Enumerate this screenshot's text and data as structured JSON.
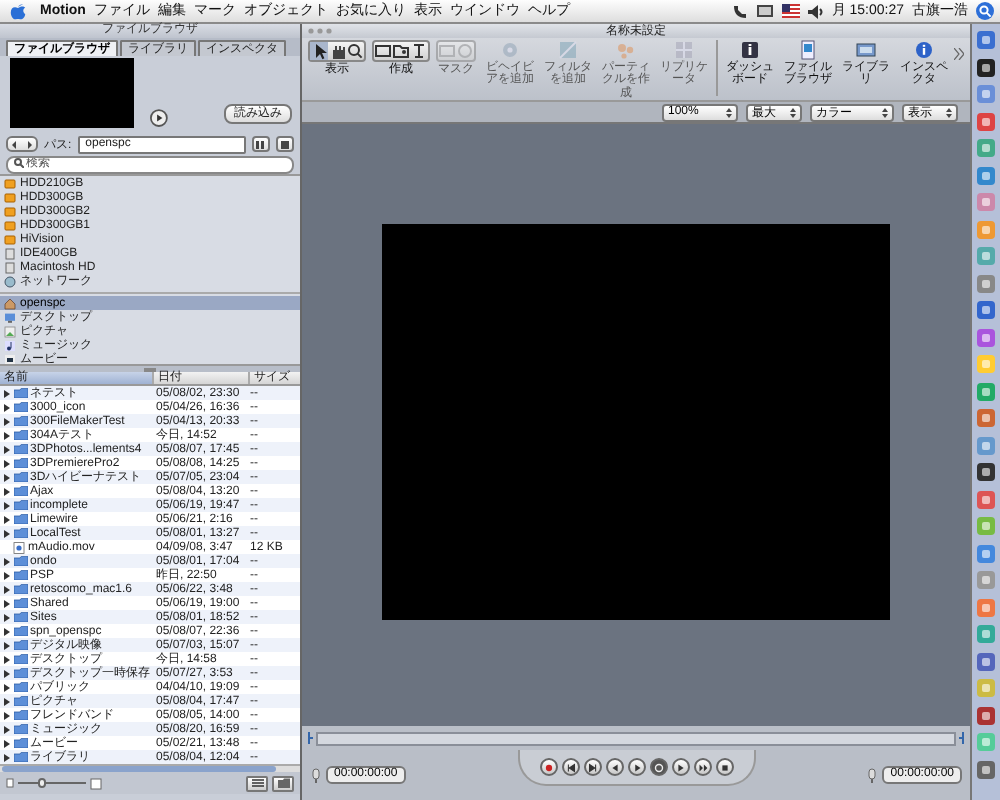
{
  "menu_bar": {
    "app_name": "Motion",
    "items": [
      "ファイル",
      "編集",
      "マーク",
      "オブジェクト",
      "お気に入り",
      "表示",
      "ウインドウ",
      "ヘルプ"
    ],
    "clock": "月 15:00:27",
    "user": "古旗一浩"
  },
  "browser": {
    "title": "ファイルブラウザ",
    "tabs": [
      {
        "label": "ファイルブラウザ",
        "selected": true
      },
      {
        "label": "ライブラリ",
        "selected": false
      },
      {
        "label": "インスペクタ",
        "selected": false
      }
    ],
    "import_button": "読み込み",
    "path_label": "パス:",
    "path_value": "openspc",
    "search_placeholder": "検索",
    "volumes": [
      {
        "label": "HDD210GB",
        "kind": "drive",
        "selected": false
      },
      {
        "label": "HDD300GB",
        "kind": "drive",
        "selected": false
      },
      {
        "label": "HDD300GB2",
        "kind": "drive",
        "selected": false
      },
      {
        "label": "HDD300GB1",
        "kind": "drive",
        "selected": false
      },
      {
        "label": "HiVision",
        "kind": "drive",
        "selected": false
      },
      {
        "label": "IDE400GB",
        "kind": "disk",
        "selected": false
      },
      {
        "label": "Macintosh HD",
        "kind": "disk",
        "selected": false
      },
      {
        "label": "ネットワーク",
        "kind": "network",
        "selected": false
      }
    ],
    "places": [
      {
        "label": "openspc",
        "kind": "home",
        "selected": true
      },
      {
        "label": "デスクトップ",
        "kind": "desktop",
        "selected": false
      },
      {
        "label": "ピクチャ",
        "kind": "pictures",
        "selected": false
      },
      {
        "label": "ミュージック",
        "kind": "music",
        "selected": false
      },
      {
        "label": "ムービー",
        "kind": "movies",
        "selected": false
      }
    ],
    "columns": [
      "名前",
      "日付",
      "サイズ"
    ],
    "files": [
      {
        "name": "ネテスト",
        "date": "05/08/02, 23:30",
        "size": "--",
        "kind": "folder"
      },
      {
        "name": "3000_icon",
        "date": "05/04/26, 16:36",
        "size": "--",
        "kind": "folder"
      },
      {
        "name": "300FileMakerTest",
        "date": "05/04/13, 20:33",
        "size": "--",
        "kind": "folder"
      },
      {
        "name": "304Aテスト",
        "date": "今日, 14:52",
        "size": "--",
        "kind": "folder"
      },
      {
        "name": "3DPhotos...lements4",
        "date": "05/08/07, 17:45",
        "size": "--",
        "kind": "folder"
      },
      {
        "name": "3DPremierePro2",
        "date": "05/08/08, 14:25",
        "size": "--",
        "kind": "folder"
      },
      {
        "name": "3Dハイビーナテスト",
        "date": "05/07/05, 23:04",
        "size": "--",
        "kind": "folder"
      },
      {
        "name": "Ajax",
        "date": "05/08/04, 13:20",
        "size": "--",
        "kind": "folder"
      },
      {
        "name": "incomplete",
        "date": "05/06/19, 19:47",
        "size": "--",
        "kind": "folder"
      },
      {
        "name": "Limewire",
        "date": "05/06/21, 2:16",
        "size": "--",
        "kind": "folder"
      },
      {
        "name": "LocalTest",
        "date": "05/08/01, 13:27",
        "size": "--",
        "kind": "folder"
      },
      {
        "name": "mAudio.mov",
        "date": "04/09/08, 3:47",
        "size": "12 KB",
        "kind": "file"
      },
      {
        "name": "ondo",
        "date": "05/08/01, 17:04",
        "size": "--",
        "kind": "folder"
      },
      {
        "name": "PSP",
        "date": "昨日, 22:50",
        "size": "--",
        "kind": "folder"
      },
      {
        "name": "retoscomo_mac1.6",
        "date": "05/06/22, 3:48",
        "size": "--",
        "kind": "folder"
      },
      {
        "name": "Shared",
        "date": "05/06/19, 19:00",
        "size": "--",
        "kind": "folder"
      },
      {
        "name": "Sites",
        "date": "05/08/01, 18:52",
        "size": "--",
        "kind": "folder"
      },
      {
        "name": "spn_openspc",
        "date": "05/08/07, 22:36",
        "size": "--",
        "kind": "folder"
      },
      {
        "name": "デジタル映像",
        "date": "05/07/03, 15:07",
        "size": "--",
        "kind": "folder"
      },
      {
        "name": "デスクトップ",
        "date": "今日, 14:58",
        "size": "--",
        "kind": "folder"
      },
      {
        "name": "デスクトップ一時保存",
        "date": "05/07/27, 3:53",
        "size": "--",
        "kind": "folder"
      },
      {
        "name": "パブリック",
        "date": "04/04/10, 19:09",
        "size": "--",
        "kind": "folder"
      },
      {
        "name": "ピクチャ",
        "date": "05/08/04, 17:47",
        "size": "--",
        "kind": "folder"
      },
      {
        "name": "フレンドバンド",
        "date": "05/08/05, 14:00",
        "size": "--",
        "kind": "folder"
      },
      {
        "name": "ミュージック",
        "date": "05/08/20, 16:59",
        "size": "--",
        "kind": "folder"
      },
      {
        "name": "ムービー",
        "date": "05/02/21, 13:48",
        "size": "--",
        "kind": "folder"
      },
      {
        "name": "ライブラリ",
        "date": "05/08/04, 12:04",
        "size": "--",
        "kind": "folder"
      }
    ],
    "icon_size_slider": {
      "level": 0.35
    }
  },
  "canvas_window": {
    "title": "名称未設定",
    "tool_groups": [
      {
        "label": "表示",
        "disabled": false
      },
      {
        "label": "作成",
        "disabled": false
      },
      {
        "label": "マスク",
        "disabled": true
      }
    ],
    "toolbar_buttons": [
      {
        "label": "ビヘイビアを追加",
        "disabled": true
      },
      {
        "label": "フィルタを追加",
        "disabled": true
      },
      {
        "label": "パーティクルを作成",
        "disabled": true
      },
      {
        "label": "リプリケータ",
        "disabled": true
      },
      {
        "label": "ダッシュボード",
        "disabled": false
      },
      {
        "label": "ファイルブラウザ",
        "disabled": false
      },
      {
        "label": "ライブラリ",
        "disabled": false
      },
      {
        "label": "インスペクタ",
        "disabled": false
      }
    ],
    "view_menus": [
      "100%",
      "最大",
      "カラー",
      "表示"
    ],
    "timecode_start": "00:00:00:00",
    "timecode_end": "00:00:00:00"
  }
}
